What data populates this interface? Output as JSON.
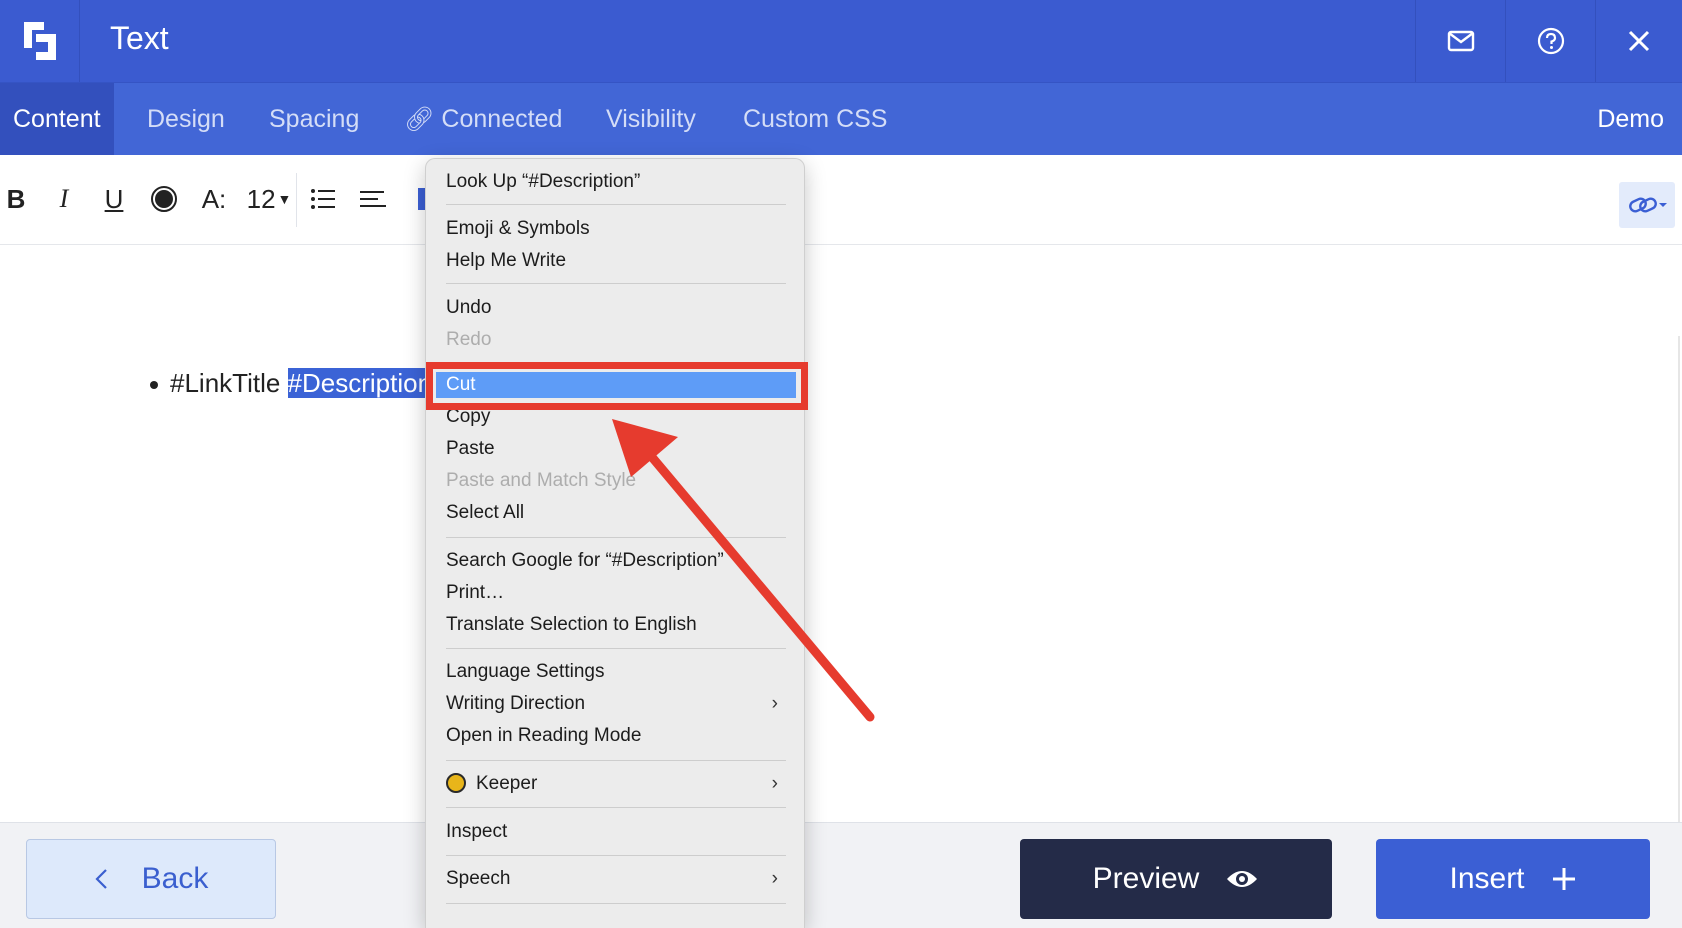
{
  "header": {
    "title": "Text",
    "logo": "app-logo-icon",
    "icons": [
      "mail-icon",
      "help-icon",
      "close-icon"
    ]
  },
  "tabs": {
    "items": [
      "Content",
      "Design",
      "Spacing",
      "Connected",
      "Visibility",
      "Custom CSS"
    ],
    "active": "Content",
    "right_label": "Demo"
  },
  "toolbar": {
    "bold": "B",
    "italic": "I",
    "underline": "U",
    "font_size_icon": "A:",
    "font_size": "12"
  },
  "editor": {
    "text_before": "#LinkTitle ",
    "selected_text": "#Description"
  },
  "context_menu": {
    "items": [
      {
        "label": "Look Up “#Description”",
        "enabled": true
      },
      {
        "label": "Emoji & Symbols",
        "enabled": true
      },
      {
        "label": "Help Me Write",
        "enabled": true
      },
      {
        "label": "Undo",
        "enabled": true
      },
      {
        "label": "Redo",
        "enabled": false
      },
      {
        "label": "Cut",
        "enabled": true,
        "highlighted": true
      },
      {
        "label": "Copy",
        "enabled": true
      },
      {
        "label": "Paste",
        "enabled": true
      },
      {
        "label": "Paste and Match Style",
        "enabled": false
      },
      {
        "label": "Select All",
        "enabled": true
      },
      {
        "label": "Search Google for “#Description”",
        "enabled": true
      },
      {
        "label": "Print…",
        "enabled": true
      },
      {
        "label": "Translate Selection to English",
        "enabled": true
      },
      {
        "label": "Language Settings",
        "enabled": true
      },
      {
        "label": "Writing Direction",
        "enabled": true,
        "submenu": true
      },
      {
        "label": "Open in Reading Mode",
        "enabled": true
      },
      {
        "label": "Keeper",
        "enabled": true,
        "submenu": true
      },
      {
        "label": "Inspect",
        "enabled": true
      },
      {
        "label": "Speech",
        "enabled": true,
        "submenu": true
      }
    ],
    "submenu_glyph": "›"
  },
  "annotation": {
    "highlight_color": "#e63b2e",
    "target": "Cut"
  },
  "footer": {
    "back_label": "Back",
    "preview_label": "Preview",
    "insert_label": "Insert"
  },
  "colors": {
    "header": "#3b5bd0",
    "tabs": "#4266d6",
    "active_tab": "#3350bd",
    "selection": "#3b63d6",
    "menu_highlight": "#5e9cf7",
    "preview_button": "#242b48",
    "insert_button": "#3b5fd4"
  }
}
